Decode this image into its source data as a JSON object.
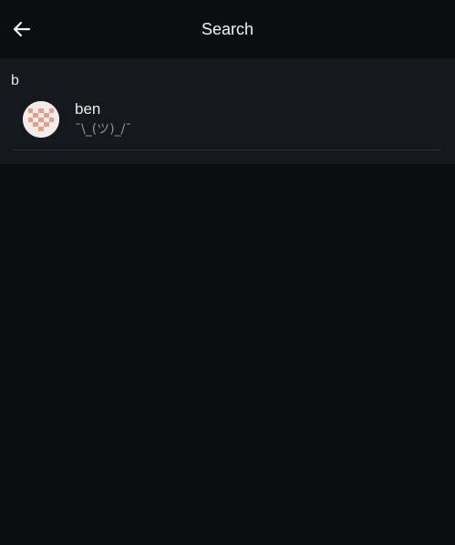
{
  "header": {
    "title": "Search",
    "back_icon": "arrow-left-icon"
  },
  "search": {
    "value": "b",
    "placeholder": ""
  },
  "results": [
    {
      "name": "ben",
      "subtitle": "¯\\_(ツ)_/¯",
      "avatar_icon": "identicon-avatar",
      "avatar_color": "#e49f8f"
    }
  ],
  "colors": {
    "background": "#0b0e11",
    "panel": "#15191d",
    "text": "#e8eaed",
    "muted": "#8a939c"
  }
}
